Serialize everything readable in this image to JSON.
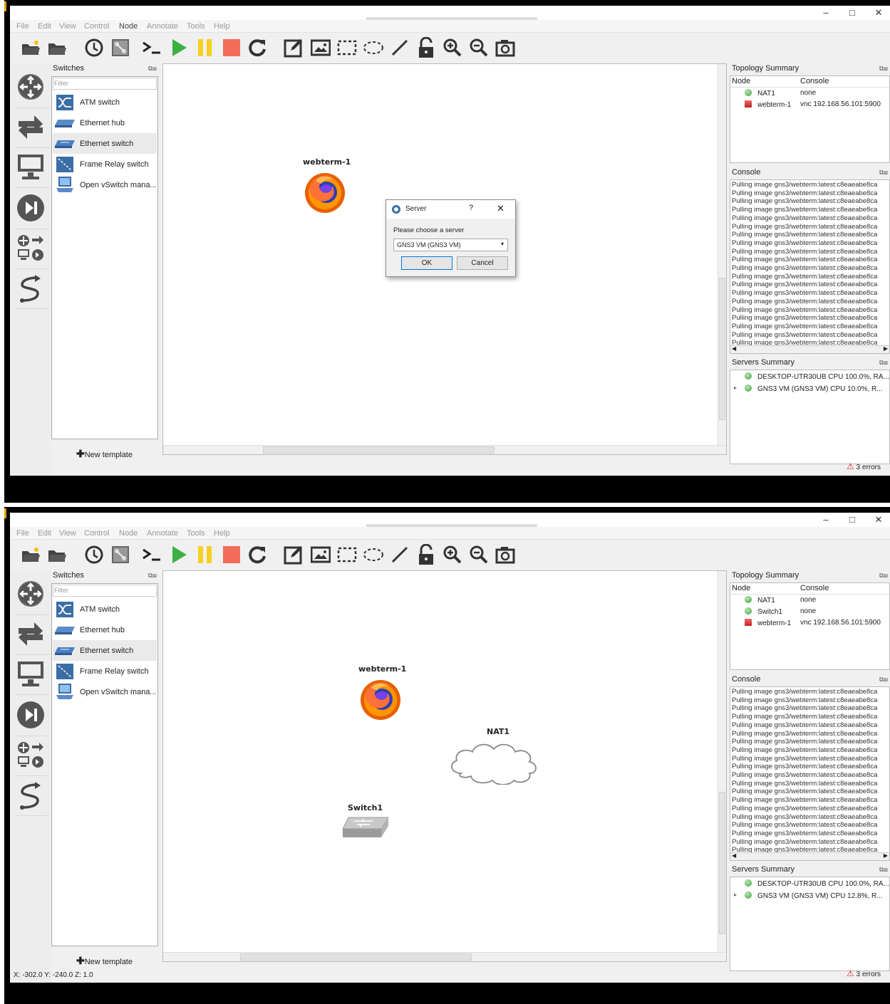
{
  "window": {
    "minimize": "–",
    "maximize": "□",
    "close": "✕"
  },
  "menu": [
    "File",
    "Edit",
    "View",
    "Control",
    "Node",
    "Annotate",
    "Tools",
    "Help"
  ],
  "toolbar_icons": [
    "open-project-icon",
    "open-folder-icon",
    "snapshot-icon",
    "show-interface-labels-icon",
    "console-all-icon",
    "start-all-icon",
    "suspend-all-icon",
    "stop-all-icon",
    "reload-all-icon",
    "add-note-icon",
    "insert-image-icon",
    "draw-rectangle-icon",
    "draw-ellipse-icon",
    "draw-line-icon",
    "lock-items-icon",
    "zoom-in-icon",
    "zoom-out-icon",
    "screenshot-icon"
  ],
  "devices_toolbar_icons": [
    "routers-icon",
    "switches-icon",
    "end-devices-icon",
    "security-devices-icon",
    "all-devices-icon",
    "add-link-icon"
  ],
  "switches_dock": {
    "title": "Switches",
    "filter_placeholder": "Filter",
    "items": [
      "ATM switch",
      "Ethernet hub",
      "Ethernet switch",
      "Frame Relay switch",
      "Open vSwitch mana..."
    ],
    "new_template": "New template"
  },
  "screen1": {
    "nodes": {
      "webterm": "webterm-1"
    },
    "dialog": {
      "title": "Server",
      "help": "?",
      "close": "✕",
      "prompt": "Please choose a server",
      "selected": "GNS3 VM (GNS3 VM)",
      "ok": "OK",
      "cancel": "Cancel"
    },
    "topology": {
      "title": "Topology Summary",
      "col_node": "Node",
      "col_console": "Console",
      "rows": [
        {
          "node": "NAT1",
          "console": "none",
          "status": "green"
        },
        {
          "node": "webterm-1",
          "console": "vnc 192.168.56.101:5900",
          "status": "red"
        }
      ]
    },
    "console": {
      "title": "Console",
      "lines": [
        "Pulling image gns3/webterm:latest:c8eaeabe8ca",
        "Pulling image gns3/webterm:latest:c8eaeabe8ca",
        "Pulling image gns3/webterm:latest:c8eaeabe8ca",
        "Pulling image gns3/webterm:latest:c8eaeabe8ca",
        "Pulling image gns3/webterm:latest:c8eaeabe8ca",
        "Pulling image gns3/webterm:latest:c8eaeabe8ca",
        "Pulling image gns3/webterm:latest:c8eaeabe8ca",
        "Pulling image gns3/webterm:latest:c8eaeabe8ca",
        "Pulling image gns3/webterm:latest:c8eaeabe8ca",
        "Pulling image gns3/webterm:latest:c8eaeabe8ca",
        "Pulling image gns3/webterm:latest:c8eaeabe8ca",
        "Pulling image gns3/webterm:latest:c8eaeabe8ca",
        "Pulling image gns3/webterm:latest:c8eaeabe8ca",
        "Pulling image gns3/webterm:latest:c8eaeabe8ca",
        "Pulling image gns3/webterm:latest:c8eaeabe8ca",
        "Pulling image gns3/webterm:latest:c8eaeabe8ca",
        "Pulling image gns3/webterm:latest:c8eaeabe8ca",
        "Pulling image gns3/webterm:latest:c8eaeabe8ca",
        "Pulling image gns3/webterm:latest:c8eaeabe8ca",
        "Pulling image gns3/webterm:latest:c8eaeabe8ca",
        "Pulling image gns3/webterm:latest:c8eaeabe8ca"
      ]
    },
    "servers": {
      "title": "Servers Summary",
      "rows": [
        "DESKTOP-UTR30UB CPU 100.0%, RA...",
        "GNS3 VM (GNS3 VM) CPU 10.0%, R..."
      ]
    },
    "errors": "3 errors"
  },
  "screen2": {
    "nodes": {
      "webterm": "webterm-1",
      "nat": "NAT1",
      "switch": "Switch1"
    },
    "topology": {
      "title": "Topology Summary",
      "col_node": "Node",
      "col_console": "Console",
      "rows": [
        {
          "node": "NAT1",
          "console": "none",
          "status": "green"
        },
        {
          "node": "Switch1",
          "console": "none",
          "status": "green"
        },
        {
          "node": "webterm-1",
          "console": "vnc 192.168.56.101:5900",
          "status": "red"
        }
      ]
    },
    "console": {
      "title": "Console",
      "lines": [
        "Pulling image gns3/webterm:latest:c8eaeabe8ca",
        "Pulling image gns3/webterm:latest:c8eaeabe8ca",
        "Pulling image gns3/webterm:latest:c8eaeabe8ca",
        "Pulling image gns3/webterm:latest:c8eaeabe8ca",
        "Pulling image gns3/webterm:latest:c8eaeabe8ca",
        "Pulling image gns3/webterm:latest:c8eaeabe8ca",
        "Pulling image gns3/webterm:latest:c8eaeabe8ca",
        "Pulling image gns3/webterm:latest:c8eaeabe8ca",
        "Pulling image gns3/webterm:latest:c8eaeabe8ca",
        "Pulling image gns3/webterm:latest:c8eaeabe8ca",
        "Pulling image gns3/webterm:latest:c8eaeabe8ca",
        "Pulling image gns3/webterm:latest:c8eaeabe8ca",
        "Pulling image gns3/webterm:latest:c8eaeabe8ca",
        "Pulling image gns3/webterm:latest:c8eaeabe8ca",
        "Pulling image gns3/webterm:latest:c8eaeabe8ca",
        "Pulling image gns3/webterm:latest:c8eaeabe8ca",
        "Pulling image gns3/webterm:latest:c8eaeabe8ca",
        "Pulling image gns3/webterm:latest:c8eaeabe8ca",
        "Pulling image gns3/webterm:latest:c8eaeabe8ca",
        "Pulling image gns3/webterm:latest:c8eaeabe8ca",
        "Pulling image gns3/webterm:latest:c8eaeabe8ca"
      ]
    },
    "servers": {
      "title": "Servers Summary",
      "rows": [
        "DESKTOP-UTR30UB CPU 100.0%, RA...",
        "GNS3 VM (GNS3 VM) CPU 12.8%, R..."
      ]
    },
    "errors": "3 errors",
    "coords": "X: -302.0 Y: -240.0 Z: 1.0"
  }
}
